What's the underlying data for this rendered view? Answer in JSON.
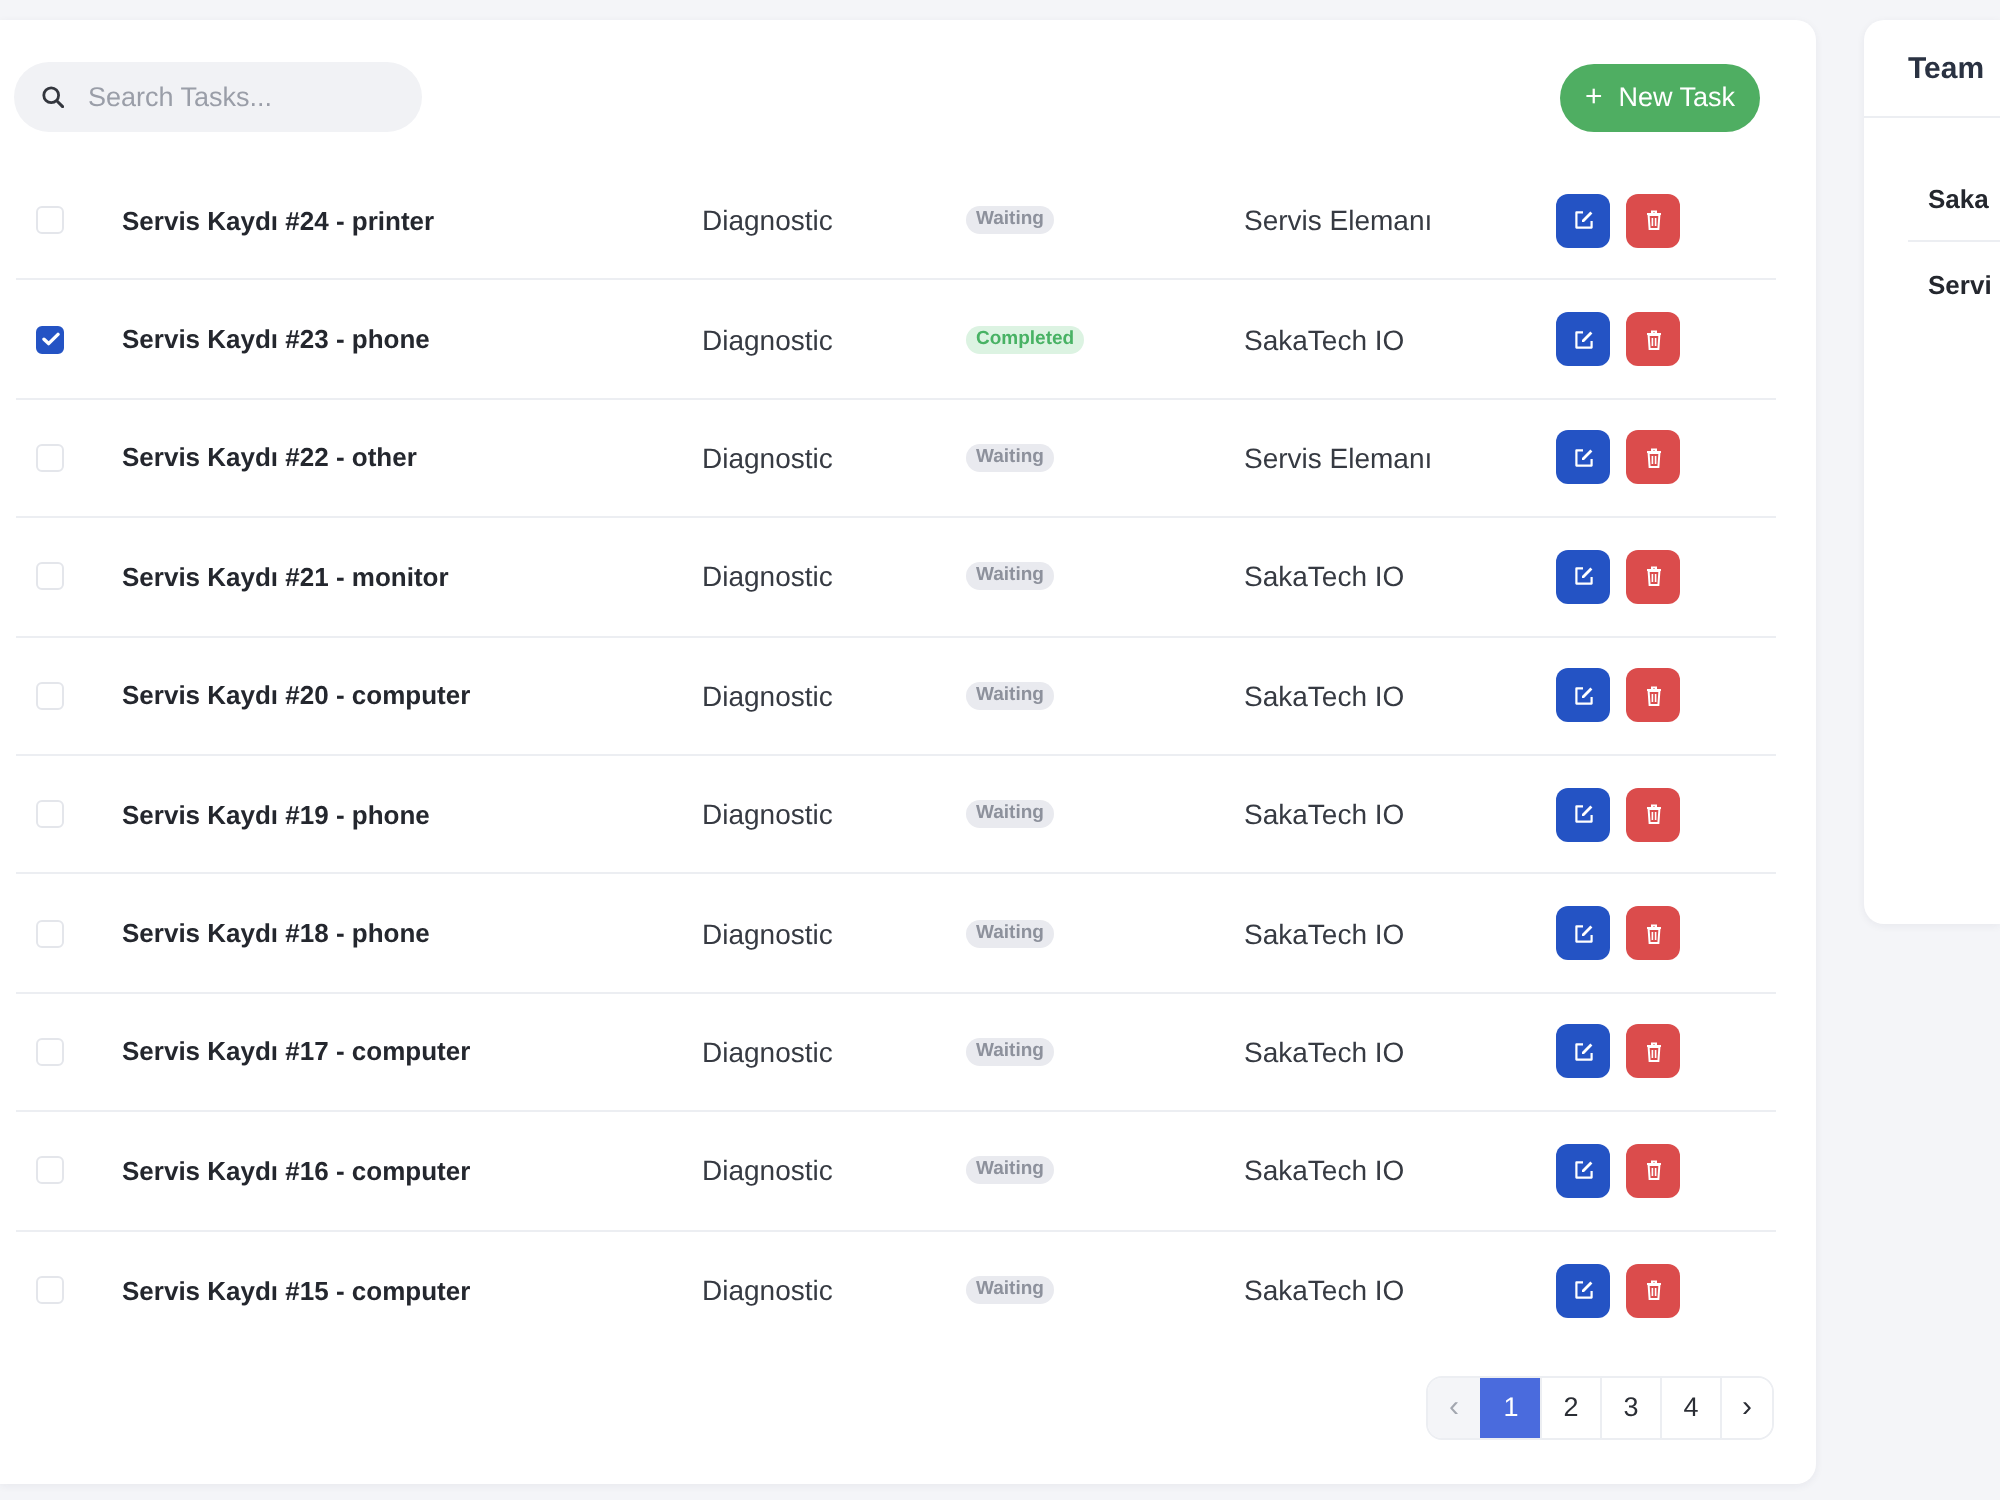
{
  "search": {
    "placeholder": "Search Tasks..."
  },
  "new_task_button": {
    "icon": "+",
    "label": "New Task"
  },
  "tasks": [
    {
      "checked": false,
      "title": "Servis Kaydı #24 - printer",
      "category": "Diagnostic",
      "status": {
        "label": "Waiting",
        "kind": "waiting"
      },
      "assignee": "Servis Elemanı"
    },
    {
      "checked": true,
      "title": "Servis Kaydı #23 - phone",
      "category": "Diagnostic",
      "status": {
        "label": "Completed",
        "kind": "completed"
      },
      "assignee": "SakaTech IO"
    },
    {
      "checked": false,
      "title": "Servis Kaydı #22 - other",
      "category": "Diagnostic",
      "status": {
        "label": "Waiting",
        "kind": "waiting"
      },
      "assignee": "Servis Elemanı"
    },
    {
      "checked": false,
      "title": "Servis Kaydı #21 - monitor",
      "category": "Diagnostic",
      "status": {
        "label": "Waiting",
        "kind": "waiting"
      },
      "assignee": "SakaTech IO"
    },
    {
      "checked": false,
      "title": "Servis Kaydı #20 - computer",
      "category": "Diagnostic",
      "status": {
        "label": "Waiting",
        "kind": "waiting"
      },
      "assignee": "SakaTech IO"
    },
    {
      "checked": false,
      "title": "Servis Kaydı #19 - phone",
      "category": "Diagnostic",
      "status": {
        "label": "Waiting",
        "kind": "waiting"
      },
      "assignee": "SakaTech IO"
    },
    {
      "checked": false,
      "title": "Servis Kaydı #18 - phone",
      "category": "Diagnostic",
      "status": {
        "label": "Waiting",
        "kind": "waiting"
      },
      "assignee": "SakaTech IO"
    },
    {
      "checked": false,
      "title": "Servis Kaydı #17 - computer",
      "category": "Diagnostic",
      "status": {
        "label": "Waiting",
        "kind": "waiting"
      },
      "assignee": "SakaTech IO"
    },
    {
      "checked": false,
      "title": "Servis Kaydı #16 - computer",
      "category": "Diagnostic",
      "status": {
        "label": "Waiting",
        "kind": "waiting"
      },
      "assignee": "SakaTech IO"
    },
    {
      "checked": false,
      "title": "Servis Kaydı #15 - computer",
      "category": "Diagnostic",
      "status": {
        "label": "Waiting",
        "kind": "waiting"
      },
      "assignee": "SakaTech IO"
    }
  ],
  "pagination": {
    "previous": {
      "label": "‹",
      "disabled": true
    },
    "pages": [
      {
        "label": "1",
        "selected": true
      },
      {
        "label": "2",
        "selected": false
      },
      {
        "label": "3",
        "selected": false
      },
      {
        "label": "4",
        "selected": false
      }
    ],
    "next": {
      "label": "›",
      "disabled": false
    }
  },
  "team_panel": {
    "title": "Team",
    "members": [
      "Saka",
      "Servi"
    ]
  }
}
